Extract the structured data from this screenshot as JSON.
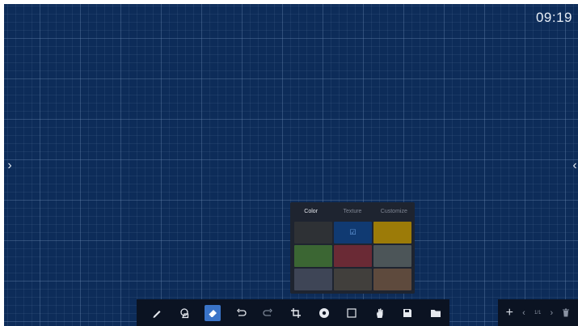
{
  "clock": {
    "time": "09:19"
  },
  "edges": {
    "left_arrow": "›",
    "right_arrow": "‹"
  },
  "palette": {
    "tabs": [
      {
        "label": "Color",
        "active": true
      },
      {
        "label": "Texture",
        "active": false
      },
      {
        "label": "Customize",
        "active": false
      }
    ],
    "swatches": [
      {
        "color": "#2e3135",
        "selected": false
      },
      {
        "color": "#103a72",
        "selected": true
      },
      {
        "color": "#9c7b08",
        "selected": false
      },
      {
        "color": "#3b6633",
        "selected": false
      },
      {
        "color": "#6a2a35",
        "selected": false
      },
      {
        "color": "#4c5558",
        "selected": false
      },
      {
        "color": "#3e4556",
        "selected": false
      },
      {
        "color": "#413f3c",
        "selected": false
      },
      {
        "color": "#5e4a3d",
        "selected": false
      }
    ],
    "check_glyph": "☑"
  },
  "toolbar": {
    "tools": [
      {
        "name": "pen-icon",
        "selected": false
      },
      {
        "name": "shape-recognition-icon",
        "selected": false
      },
      {
        "name": "eraser-icon",
        "selected": true
      },
      {
        "name": "undo-icon",
        "selected": false
      },
      {
        "name": "redo-icon",
        "selected": false
      },
      {
        "name": "crop-icon",
        "selected": false
      },
      {
        "name": "background-icon",
        "selected": false
      },
      {
        "name": "select-box-icon",
        "selected": false
      },
      {
        "name": "roam-hand-icon",
        "selected": false
      },
      {
        "name": "save-icon",
        "selected": false
      },
      {
        "name": "folder-icon",
        "selected": false
      }
    ],
    "accent": "#3a74c8"
  },
  "pager": {
    "add": "+",
    "prev": "‹",
    "page": "1/1",
    "next": "›",
    "delete_icon": "trash-icon"
  },
  "colors": {
    "board": "#0d2c59",
    "toolbar": "#0b1322",
    "palette": "#1e2430"
  }
}
